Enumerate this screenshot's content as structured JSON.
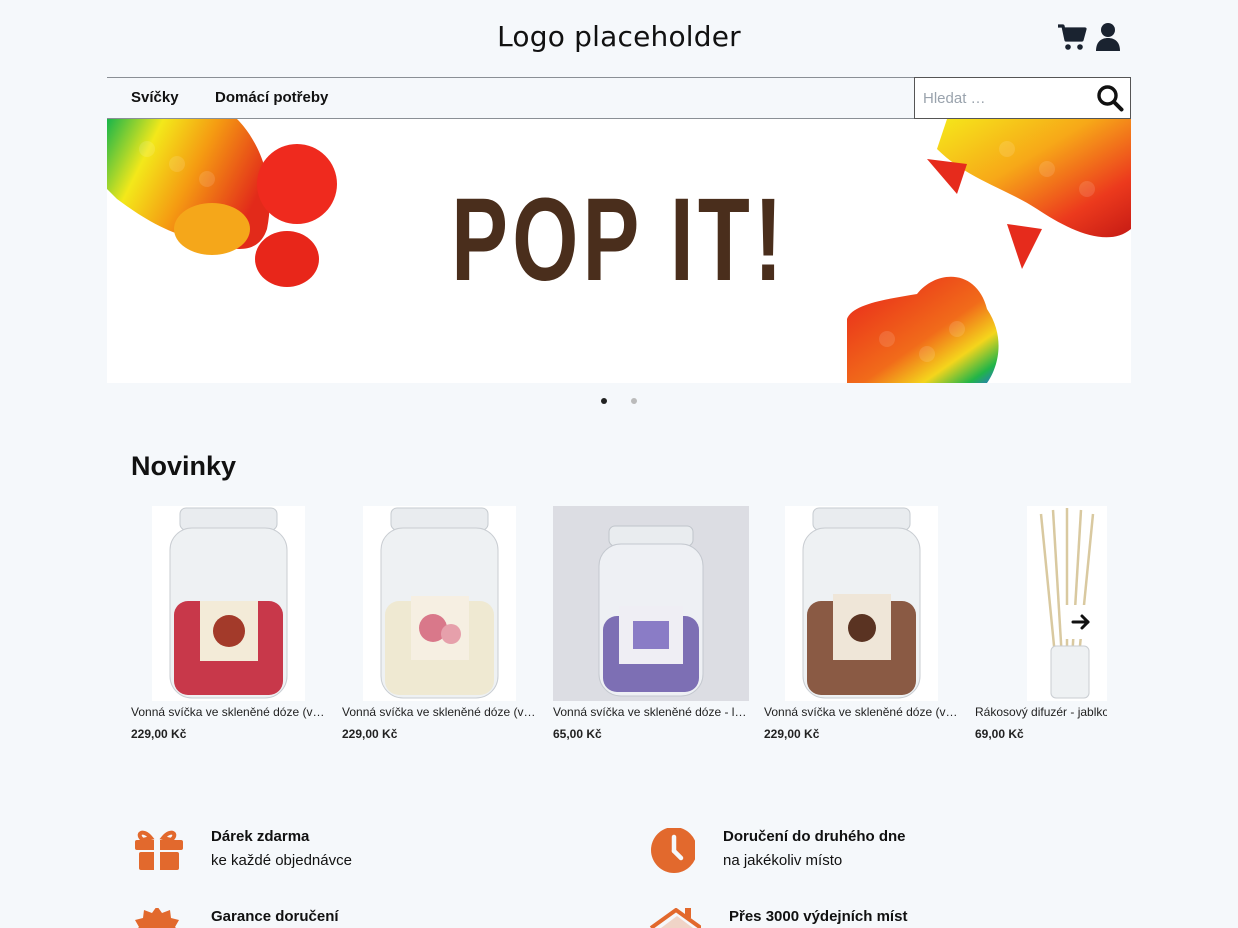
{
  "header": {
    "logo_text": "Logo placeholder",
    "icons": [
      "cart-icon",
      "user-icon"
    ]
  },
  "nav": {
    "items": [
      {
        "label": "Svíčky"
      },
      {
        "label": "Domácí potřeby"
      }
    ],
    "search": {
      "placeholder": "Hledat …",
      "value": ""
    }
  },
  "banner": {
    "slides": [
      {
        "title": "POP IT!"
      },
      {
        "title": ""
      }
    ],
    "active_slide": 0
  },
  "new_products": {
    "title": "Novinky",
    "items": [
      {
        "name": "Vonná svíčka ve skleněné dóze (velká) - jablko a skořice",
        "price": "229,00 Kč",
        "wax_color": "#c8384a",
        "bg": "#ffffff"
      },
      {
        "name": "Vonná svíčka ve skleněné dóze (velká) - květiny",
        "price": "229,00 Kč",
        "wax_color": "#efe9d2",
        "bg": "#ffffff"
      },
      {
        "name": "Vonná svíčka ve skleněné dóze - levandule",
        "price": "65,00 Kč",
        "wax_color": "#7d6fb4",
        "bg": "#dcdde3"
      },
      {
        "name": "Vonná svíčka ve skleněné dóze (velká) - káva",
        "price": "229,00 Kč",
        "wax_color": "#8a5a44",
        "bg": "#ffffff"
      },
      {
        "name": "Rákosový difuzér - jablko a skořice",
        "price": "69,00 Kč",
        "wax_color": "#d9c9a0",
        "bg": "#ffffff"
      }
    ]
  },
  "features": [
    {
      "title": "Dárek zdarma",
      "subtitle": "ke každé objednávce",
      "icon": "gift-icon"
    },
    {
      "title": "Doručení do druhého dne",
      "subtitle": "na jakékoliv místo",
      "icon": "clock-icon"
    },
    {
      "title": "Garance doručení",
      "subtitle": "",
      "icon": "badge-icon"
    },
    {
      "title": "Přes 3000 výdejních míst",
      "subtitle": "",
      "icon": "house-icon"
    }
  ],
  "colors": {
    "accent": "#e2692d",
    "text": "#111111",
    "background": "#f5f8fb",
    "banner_text": "#4a2e1c"
  }
}
